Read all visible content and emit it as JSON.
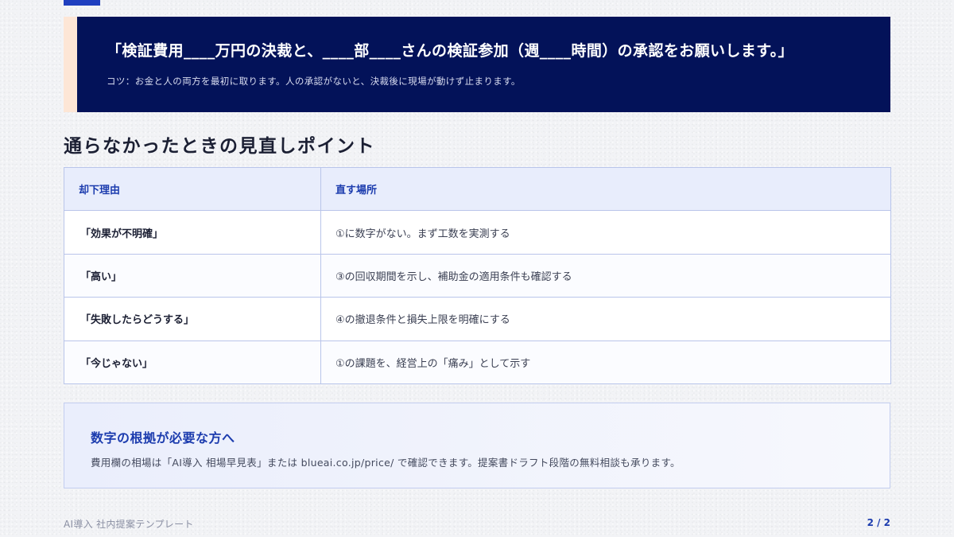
{
  "colors": {
    "navy": "#031259",
    "accent_blue": "#1c3cae",
    "peach": "#fde6d6",
    "table_header_bg": "#e8edfc",
    "border": "#b9c5ea"
  },
  "banner": {
    "quote": "「検証費用____万円の決裁と、____部____さんの検証参加（週____時間）の承認をお願いします。」",
    "tip": "コツ：お金と人の両方を最初に取ります。人の承認がないと、決裁後に現場が動けず止まります。"
  },
  "section": {
    "heading": "通らなかったときの見直しポイント"
  },
  "table": {
    "headers": [
      "却下理由",
      "直す場所"
    ],
    "rows": [
      [
        "「効果が不明確」",
        "①に数字がない。まず工数を実測する"
      ],
      [
        "「高い」",
        "③の回収期間を示し、補助金の適用条件も確認する"
      ],
      [
        "「失敗したらどうする」",
        "④の撤退条件と損失上限を明確にする"
      ],
      [
        "「今じゃない」",
        "①の課題を、経営上の「痛み」として示す"
      ]
    ]
  },
  "info": {
    "title": "数字の根拠が必要な方へ",
    "text": "費用欄の相場は「AI導入 相場早見表」または blueai.co.jp/price/ で確認できます。提案書ドラフト段階の無料相談も承ります。"
  },
  "footer": {
    "title": "AI導入 社内提案テンプレート",
    "page": "2 / 2"
  }
}
